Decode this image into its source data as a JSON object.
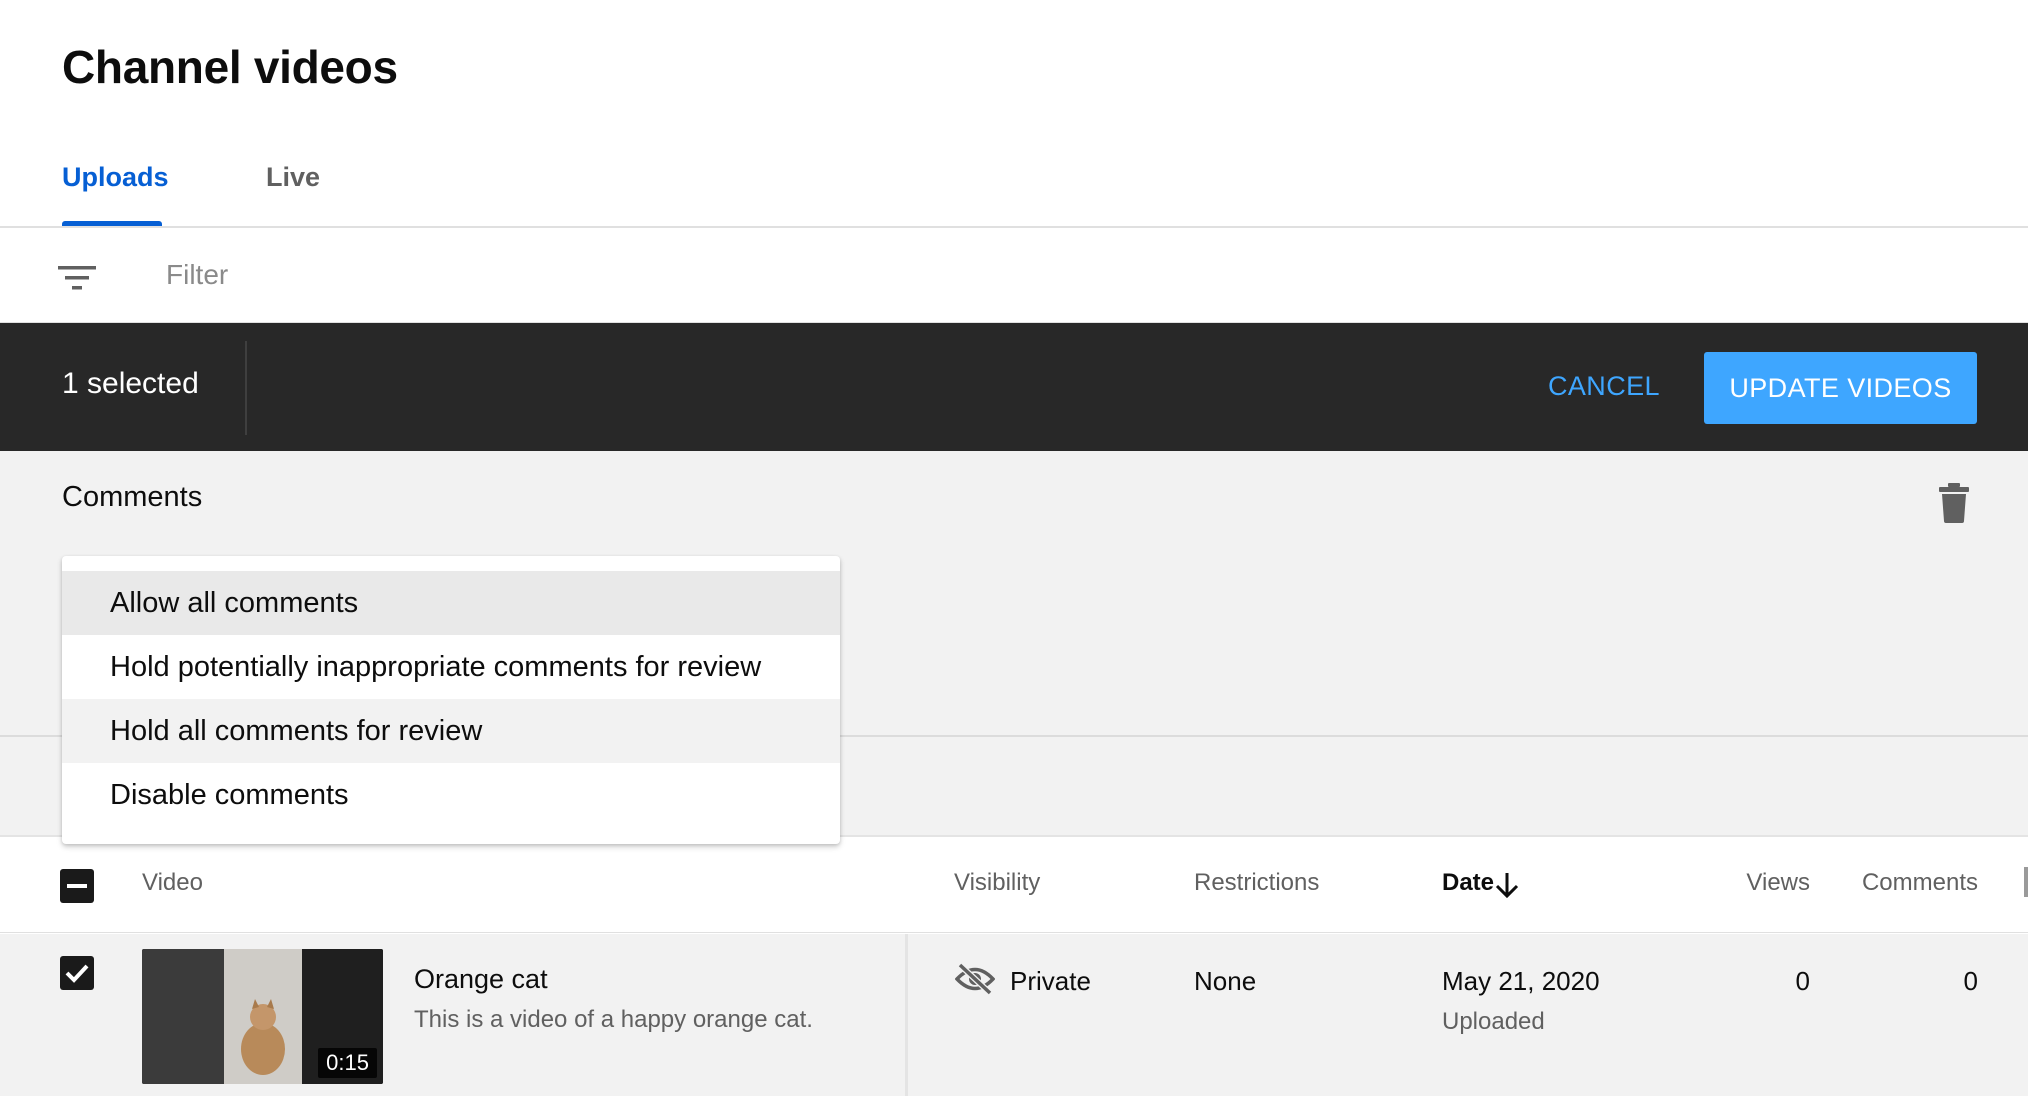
{
  "header": {
    "title": "Channel videos"
  },
  "tabs": [
    {
      "label": "Uploads",
      "active": true
    },
    {
      "label": "Live",
      "active": false
    }
  ],
  "filter": {
    "placeholder": "Filter",
    "value": "",
    "icon": "filter-list-icon"
  },
  "selection_bar": {
    "selected_text": "1 selected",
    "cancel_label": "CANCEL",
    "update_label": "UPDATE VIDEOS"
  },
  "edit_panel": {
    "field_label": "Comments",
    "delete_icon": "trash-icon",
    "dropdown_options": [
      "Allow all comments",
      "Hold potentially inappropriate comments for review",
      "Hold all comments for review",
      "Disable comments"
    ],
    "highlighted_option": "Allow all comments"
  },
  "table": {
    "columns": {
      "video": "Video",
      "visibility": "Visibility",
      "restrictions": "Restrictions",
      "date": "Date",
      "views": "Views",
      "comments": "Comments"
    },
    "sort": {
      "column": "Date",
      "direction": "descending",
      "icon": "arrow-down-icon"
    },
    "rows": [
      {
        "selected": true,
        "title": "Orange cat",
        "description": "This is a video of a happy orange cat.",
        "duration": "0:15",
        "visibility": "Private",
        "visibility_icon": "eye-off-icon",
        "restrictions": "None",
        "date": "May 21, 2020",
        "date_status": "Uploaded",
        "views": "0",
        "comments": "0"
      }
    ]
  },
  "colors": {
    "accent_blue": "#065fd4",
    "button_blue": "#3ea6ff",
    "selection_bar": "#282828",
    "panel_bg": "#f2f2f2"
  }
}
